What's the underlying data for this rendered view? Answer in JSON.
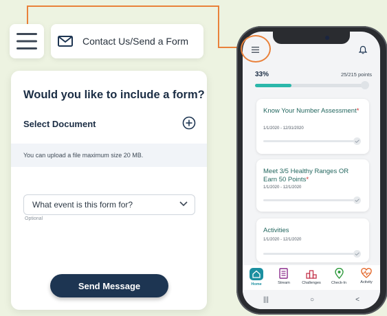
{
  "callout": {
    "color": "#e9813a"
  },
  "contact": {
    "label": "Contact Us/Send a Form"
  },
  "form": {
    "title": "Would you like to include a form?",
    "select_document": "Select Document",
    "upload_note": "You can upload a file maximum size 20 MB.",
    "event_select": {
      "value": "What event is this form for?"
    },
    "optional": "Optional",
    "send_label": "Send Message"
  },
  "phone": {
    "progress": {
      "percent_label": "33%",
      "points_label": "25/215 points",
      "fraction": 0.33
    },
    "tasks": [
      {
        "title": "Know Your Number Assessment",
        "required": "*",
        "dates": "1/1/2020 - 12/31/2020"
      },
      {
        "title": "Meet 3/5 Healthy Ranges OR Earn 50 Points",
        "required": "*",
        "dates": "1/1/2020 - 12/1/2020"
      },
      {
        "title": "Activities",
        "required": "",
        "dates": "1/1/2020 - 12/1/2020"
      }
    ],
    "tabs": [
      {
        "label": "Home",
        "icon": "home-icon",
        "active": true
      },
      {
        "label": "Stream",
        "icon": "stream-icon"
      },
      {
        "label": "Challenges",
        "icon": "podium-icon"
      },
      {
        "label": "Check-In",
        "icon": "location-pin-icon"
      },
      {
        "label": "Activity",
        "icon": "heart-pulse-icon"
      }
    ],
    "nav": {
      "recents": "|||",
      "home": "○",
      "back": "<"
    }
  },
  "colors": {
    "accent": "#e9813a",
    "teal": "#2bb7aa",
    "navy": "#1d3552"
  }
}
